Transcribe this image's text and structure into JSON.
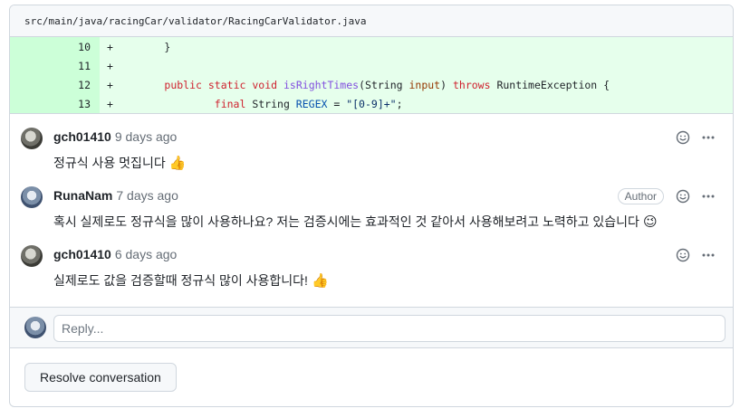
{
  "file": {
    "path": "src/main/java/racingCar/validator/RacingCarValidator.java"
  },
  "diff": {
    "lines": [
      {
        "number": "10",
        "sign": "+",
        "indent": "        ",
        "parts": [
          {
            "text": "}",
            "cls": ""
          }
        ]
      },
      {
        "number": "11",
        "sign": "+",
        "indent": "",
        "parts": []
      },
      {
        "number": "12",
        "sign": "+",
        "indent": "        ",
        "parts": [
          {
            "text": "public",
            "cls": "kw"
          },
          {
            "text": " ",
            "cls": ""
          },
          {
            "text": "static",
            "cls": "kw"
          },
          {
            "text": " ",
            "cls": ""
          },
          {
            "text": "void",
            "cls": "kw"
          },
          {
            "text": " ",
            "cls": ""
          },
          {
            "text": "isRightTimes",
            "cls": "fn"
          },
          {
            "text": "(String ",
            "cls": ""
          },
          {
            "text": "input",
            "cls": "var"
          },
          {
            "text": ") ",
            "cls": ""
          },
          {
            "text": "throws",
            "cls": "kw"
          },
          {
            "text": " RuntimeException {",
            "cls": ""
          }
        ]
      },
      {
        "number": "13",
        "sign": "+",
        "indent": "                ",
        "parts": [
          {
            "text": "final",
            "cls": "kw"
          },
          {
            "text": " String ",
            "cls": ""
          },
          {
            "text": "REGEX",
            "cls": "const"
          },
          {
            "text": " = ",
            "cls": ""
          },
          {
            "text": "\"[0-9]+\"",
            "cls": "str"
          },
          {
            "text": ";",
            "cls": ""
          }
        ]
      }
    ]
  },
  "comments": [
    {
      "author": "gch01410",
      "time": "9 days ago",
      "body": "정규식 사용 멋집니다",
      "emoji": "👍",
      "emoji_name": "thumbs-up",
      "is_author": false,
      "avatar": "gray"
    },
    {
      "author": "RunaNam",
      "time": "7 days ago",
      "body": "혹시 실제로도 정규식을 많이 사용하나요? 저는 검증시에는 효과적인 것 같아서 사용해보려고 노력하고 있습니다",
      "emoji": "😉",
      "emoji_name": "winking-face",
      "is_author": true,
      "avatar": "blue"
    },
    {
      "author": "gch01410",
      "time": "6 days ago",
      "body": "실제로도 값을 검증할때 정규식 많이 사용합니다!",
      "emoji": "👍",
      "emoji_name": "thumbs-up",
      "is_author": false,
      "avatar": "gray"
    }
  ],
  "labels": {
    "author_badge": "Author"
  },
  "reply": {
    "placeholder": "Reply..."
  },
  "resolve": {
    "label": "Resolve conversation"
  },
  "colors": {
    "diff_added_code": "#e6ffec",
    "diff_added_number": "#ccffd8",
    "border": "#d0d7de",
    "muted_text": "#656d76"
  }
}
